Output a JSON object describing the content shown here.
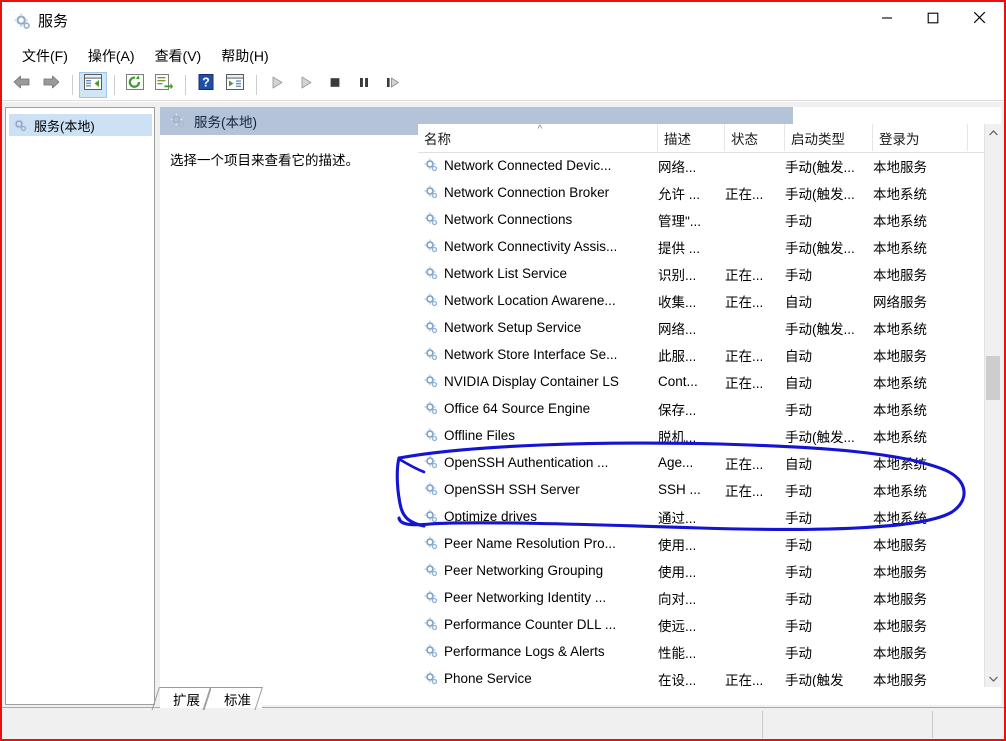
{
  "window": {
    "title": "服务",
    "title_icon": "services-gear-icon",
    "minimize_label": "最小化",
    "maximize_label": "最大化",
    "close_label": "关闭"
  },
  "menubar": {
    "items": [
      {
        "label": "文件(F)",
        "name": "menu-file"
      },
      {
        "label": "操作(A)",
        "name": "menu-action"
      },
      {
        "label": "查看(V)",
        "name": "menu-view"
      },
      {
        "label": "帮助(H)",
        "name": "menu-help"
      }
    ]
  },
  "toolbar": {
    "buttons": [
      {
        "name": "back-button",
        "icon": "arrow-left-icon",
        "enabled": true
      },
      {
        "name": "forward-button",
        "icon": "arrow-right-icon",
        "enabled": true
      },
      {
        "name": "show-hide-console-tree-button",
        "icon": "console-tree-icon",
        "selected": true
      },
      {
        "name": "refresh-button",
        "icon": "refresh-icon",
        "enabled": true
      },
      {
        "name": "export-list-button",
        "icon": "export-list-icon",
        "enabled": true
      },
      {
        "name": "help-button",
        "icon": "help-question-icon",
        "enabled": true
      },
      {
        "name": "properties-button",
        "icon": "properties-icon",
        "enabled": true
      },
      {
        "name": "start-service-button",
        "icon": "play-triangle-icon",
        "enabled": false
      },
      {
        "name": "resume-service-button",
        "icon": "play-triangle-icon",
        "enabled": false
      },
      {
        "name": "stop-service-button",
        "icon": "stop-square-icon",
        "enabled": true
      },
      {
        "name": "pause-service-button",
        "icon": "pause-bars-icon",
        "enabled": true
      },
      {
        "name": "restart-service-button",
        "icon": "restart-icon",
        "enabled": true
      }
    ]
  },
  "tree": {
    "items": [
      {
        "label": "服务(本地)",
        "icon": "services-gear-icon",
        "selected": true
      }
    ]
  },
  "detail_pane": {
    "header": "服务(本地)",
    "header_icon": "services-gear-icon",
    "description": "选择一个项目来查看它的描述。"
  },
  "list": {
    "columns": [
      {
        "label": "名称",
        "name": "column-name",
        "sorted": true,
        "sort_direction": "asc"
      },
      {
        "label": "描述",
        "name": "column-description"
      },
      {
        "label": "状态",
        "name": "column-status"
      },
      {
        "label": "启动类型",
        "name": "column-startup-type"
      },
      {
        "label": "登录为",
        "name": "column-log-on-as"
      }
    ],
    "rows": [
      {
        "name": "Network Connected Devic...",
        "description": "网络...",
        "status": "",
        "startup": "手动(触发...",
        "logon": "本地服务"
      },
      {
        "name": "Network Connection Broker",
        "description": "允许 ...",
        "status": "正在...",
        "startup": "手动(触发...",
        "logon": "本地系统"
      },
      {
        "name": "Network Connections",
        "description": "管理\"...",
        "status": "",
        "startup": "手动",
        "logon": "本地系统"
      },
      {
        "name": "Network Connectivity Assis...",
        "description": "提供 ...",
        "status": "",
        "startup": "手动(触发...",
        "logon": "本地系统"
      },
      {
        "name": "Network List Service",
        "description": "识别...",
        "status": "正在...",
        "startup": "手动",
        "logon": "本地服务"
      },
      {
        "name": "Network Location Awarene...",
        "description": "收集...",
        "status": "正在...",
        "startup": "自动",
        "logon": "网络服务"
      },
      {
        "name": "Network Setup Service",
        "description": "网络...",
        "status": "",
        "startup": "手动(触发...",
        "logon": "本地系统"
      },
      {
        "name": "Network Store Interface Se...",
        "description": "此服...",
        "status": "正在...",
        "startup": "自动",
        "logon": "本地服务"
      },
      {
        "name": "NVIDIA Display Container LS",
        "description": "Cont...",
        "status": "正在...",
        "startup": "自动",
        "logon": "本地系统"
      },
      {
        "name": "Office 64 Source Engine",
        "description": "保存...",
        "status": "",
        "startup": "手动",
        "logon": "本地系统"
      },
      {
        "name": "Offline Files",
        "description": "脱机...",
        "status": "",
        "startup": "手动(触发...",
        "logon": "本地系统"
      },
      {
        "name": "OpenSSH Authentication ...",
        "description": "Age...",
        "status": "正在...",
        "startup": "自动",
        "logon": "本地系统"
      },
      {
        "name": "OpenSSH SSH Server",
        "description": "SSH ...",
        "status": "正在...",
        "startup": "手动",
        "logon": "本地系统"
      },
      {
        "name": "Optimize drives",
        "description": "通过...",
        "status": "",
        "startup": "手动",
        "logon": "本地系统"
      },
      {
        "name": "Peer Name Resolution Pro...",
        "description": "使用...",
        "status": "",
        "startup": "手动",
        "logon": "本地服务"
      },
      {
        "name": "Peer Networking Grouping",
        "description": "使用...",
        "status": "",
        "startup": "手动",
        "logon": "本地服务"
      },
      {
        "name": "Peer Networking Identity ...",
        "description": "向对...",
        "status": "",
        "startup": "手动",
        "logon": "本地服务"
      },
      {
        "name": "Performance Counter DLL ...",
        "description": "使远...",
        "status": "",
        "startup": "手动",
        "logon": "本地服务"
      },
      {
        "name": "Performance Logs & Alerts",
        "description": "性能...",
        "status": "",
        "startup": "手动",
        "logon": "本地服务"
      },
      {
        "name": "Phone Service",
        "description": "在设...",
        "status": "正在...",
        "startup": "手动(触发",
        "logon": "本地服务"
      }
    ]
  },
  "tabs": [
    {
      "label": "扩展",
      "name": "tab-extended",
      "selected": false
    },
    {
      "label": "标准",
      "name": "tab-standard",
      "selected": true
    }
  ],
  "annotation": {
    "type": "freehand-ellipse",
    "color": "#1414d2",
    "encircles": [
      "OpenSSH Authentication ...",
      "OpenSSH SSH Server"
    ]
  },
  "colors": {
    "accent_header": "#b4c3d7",
    "selection": "#cde1f5",
    "ink": "#1414d2",
    "capture_border": "#e8110f"
  },
  "statusbar": {
    "text": ""
  }
}
